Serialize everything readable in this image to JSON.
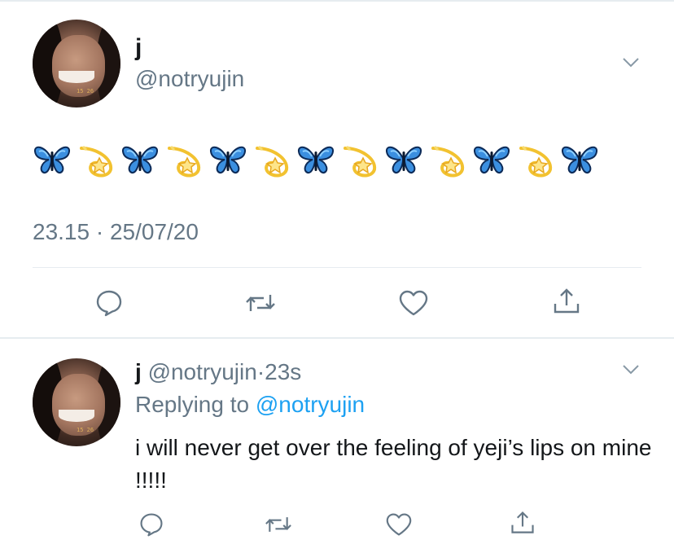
{
  "colors": {
    "text": "#14171a",
    "muted": "#657786",
    "link": "#1da1f2",
    "border": "#e6ecf0"
  },
  "tweet": {
    "display_name": "j",
    "handle": "@notryujin",
    "emoji_sequence": [
      "butterfly",
      "dizzy",
      "butterfly",
      "dizzy",
      "butterfly",
      "dizzy",
      "butterfly",
      "dizzy",
      "butterfly",
      "dizzy",
      "butterfly",
      "dizzy",
      "butterfly"
    ],
    "timestamp": "23.15 · 25/07/20",
    "actions": [
      "reply-icon",
      "retweet-icon",
      "like-icon",
      "share-icon"
    ]
  },
  "reply": {
    "display_name": "j",
    "handle": "@notryujin",
    "dot": "·",
    "time": "23s",
    "replying_prefix": "Replying to",
    "replying_handle": "@notryujin",
    "text": "i will never get over the feeling of yeji’s lips on mine !!!!!",
    "actions": [
      "reply-icon",
      "retweet-icon",
      "like-icon",
      "share-icon"
    ]
  }
}
